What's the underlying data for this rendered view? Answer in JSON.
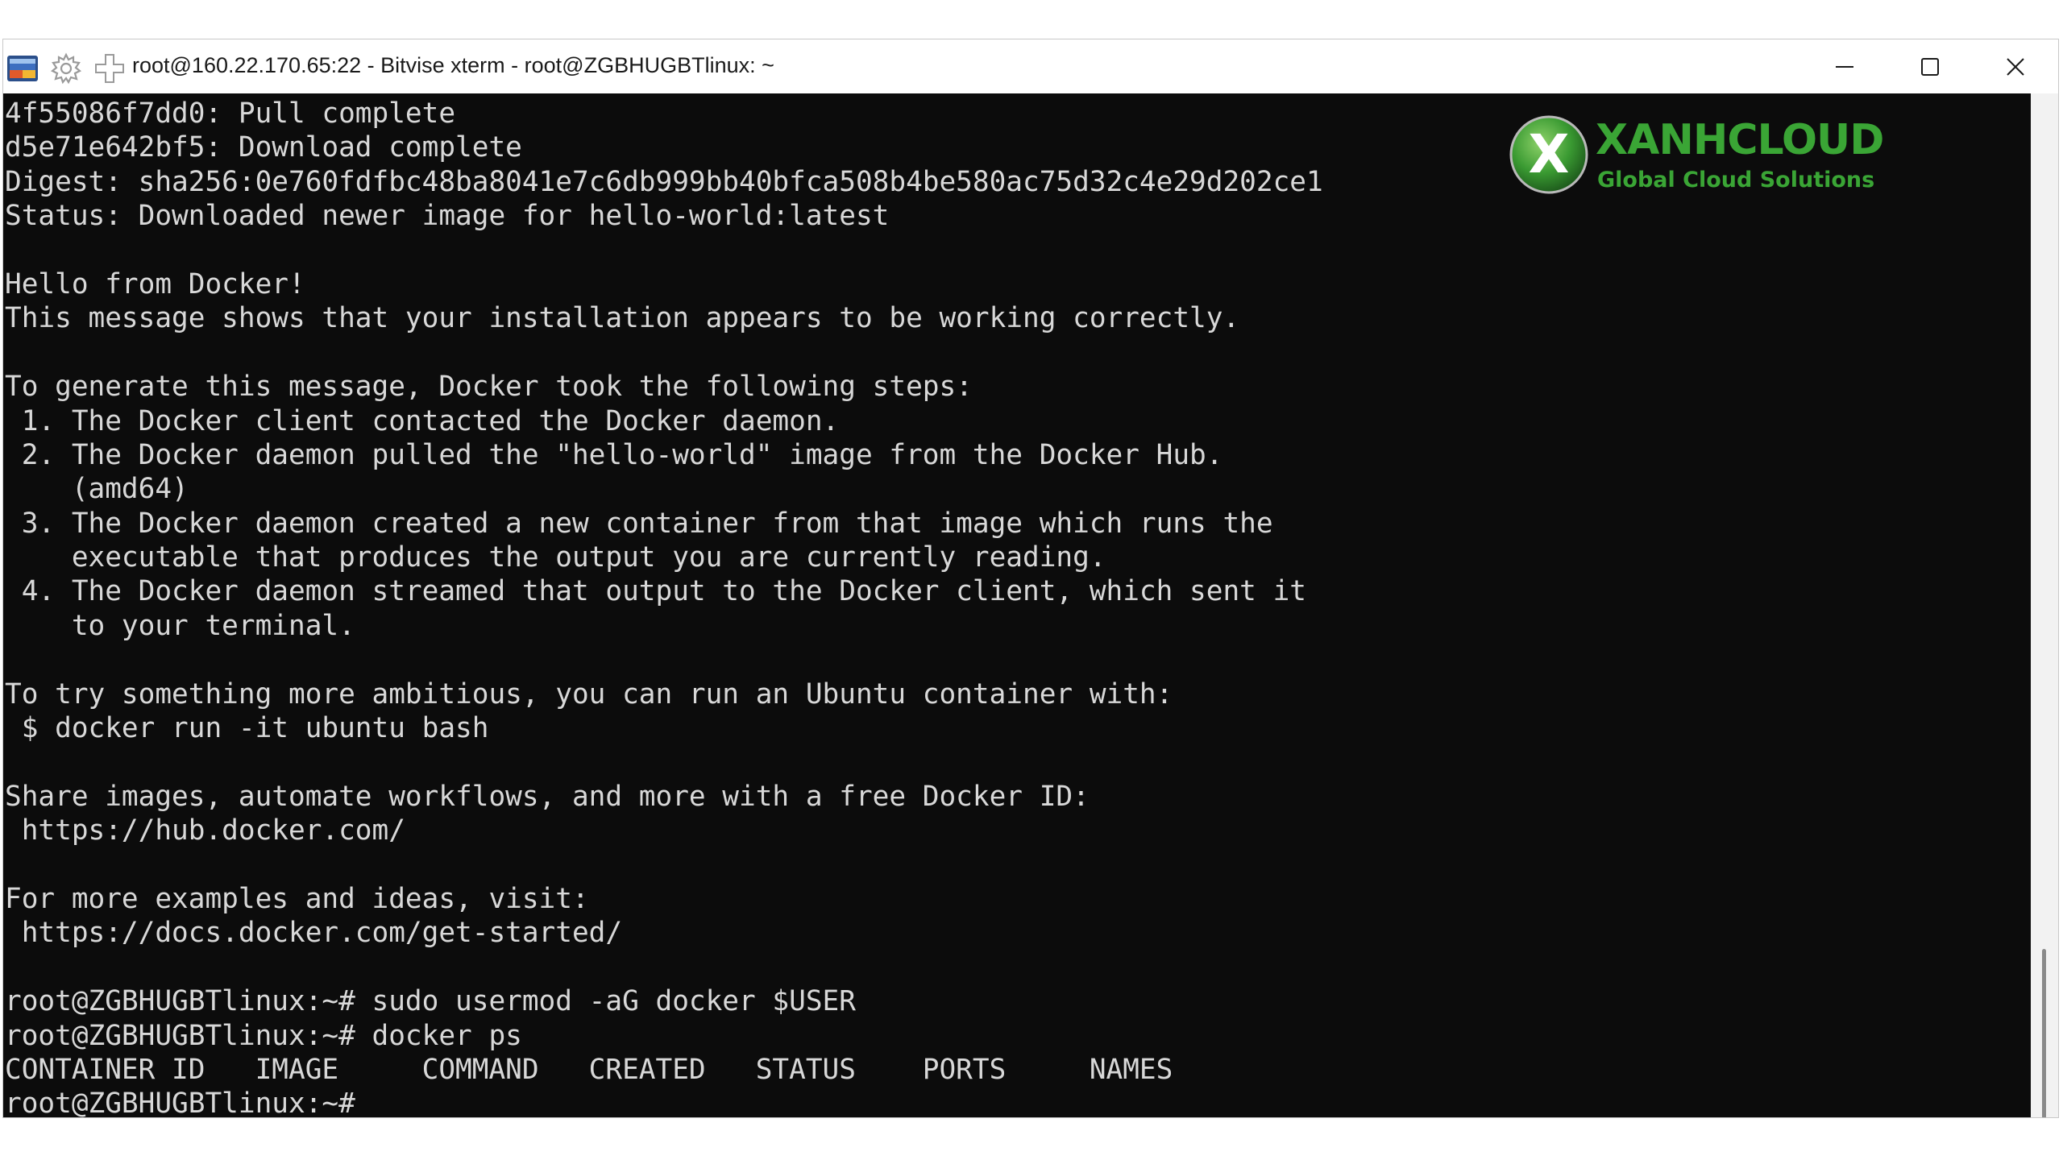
{
  "window": {
    "title": "root@160.22.170.65:22 - Bitvise xterm - root@ZGBHUGBTlinux: ~"
  },
  "colors": {
    "terminal_bg": "#0c0c0c",
    "terminal_fg": "#d8d8d8",
    "logo_green": "#3aa535"
  },
  "icons": {
    "app": "bitvise-app-icon",
    "settings": "gear-icon",
    "new": "plus-icon",
    "minimize": "minimize-icon",
    "maximize": "maximize-icon",
    "close": "close-icon"
  },
  "logo": {
    "name": "XANHCLOUD",
    "tagline": "Global Cloud Solutions",
    "mark": "X"
  },
  "terminal": {
    "lines": [
      "4f55086f7dd0: Pull complete",
      "d5e71e642bf5: Download complete",
      "Digest: sha256:0e760fdfbc48ba8041e7c6db999bb40bfca508b4be580ac75d32c4e29d202ce1",
      "Status: Downloaded newer image for hello-world:latest",
      "",
      "Hello from Docker!",
      "This message shows that your installation appears to be working correctly.",
      "",
      "To generate this message, Docker took the following steps:",
      " 1. The Docker client contacted the Docker daemon.",
      " 2. The Docker daemon pulled the \"hello-world\" image from the Docker Hub.",
      "    (amd64)",
      " 3. The Docker daemon created a new container from that image which runs the",
      "    executable that produces the output you are currently reading.",
      " 4. The Docker daemon streamed that output to the Docker client, which sent it",
      "    to your terminal.",
      "",
      "To try something more ambitious, you can run an Ubuntu container with:",
      " $ docker run -it ubuntu bash",
      "",
      "Share images, automate workflows, and more with a free Docker ID:",
      " https://hub.docker.com/",
      "",
      "For more examples and ideas, visit:",
      " https://docs.docker.com/get-started/",
      "",
      "root@ZGBHUGBTlinux:~# sudo usermod -aG docker $USER",
      "root@ZGBHUGBTlinux:~# docker ps",
      "CONTAINER ID   IMAGE     COMMAND   CREATED   STATUS    PORTS     NAMES",
      "root@ZGBHUGBTlinux:~#"
    ]
  }
}
